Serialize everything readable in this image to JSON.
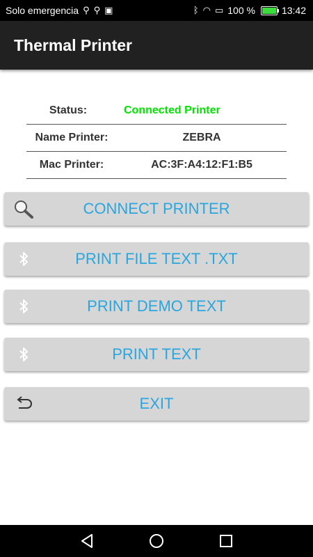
{
  "statusbar": {
    "carrier": "Solo emergencia",
    "battery": "100 %",
    "time": "13:42"
  },
  "appbar": {
    "title": "Thermal Printer"
  },
  "info": {
    "status_label": "Status:",
    "status_value": "Connected Printer",
    "name_label": "Name Printer:",
    "name_value": "ZEBRA",
    "mac_label": "Mac Printer:",
    "mac_value": "AC:3F:A4:12:F1:B5"
  },
  "buttons": {
    "connect": "CONNECT PRINTER",
    "print_file": "PRINT FILE TEXT .TXT",
    "print_demo": "PRINT DEMO TEXT",
    "print_text": "PRINT TEXT",
    "exit": "EXIT"
  },
  "icons": {
    "connect": "search-icon",
    "print_file": "bluetooth-icon",
    "print_demo": "bluetooth-icon",
    "print_text": "bluetooth-icon",
    "exit": "undo-icon"
  },
  "colors": {
    "accent": "#2aa6df",
    "status_ok": "#00e400",
    "appbar": "#212121",
    "button_bg": "#d6d6d6"
  }
}
